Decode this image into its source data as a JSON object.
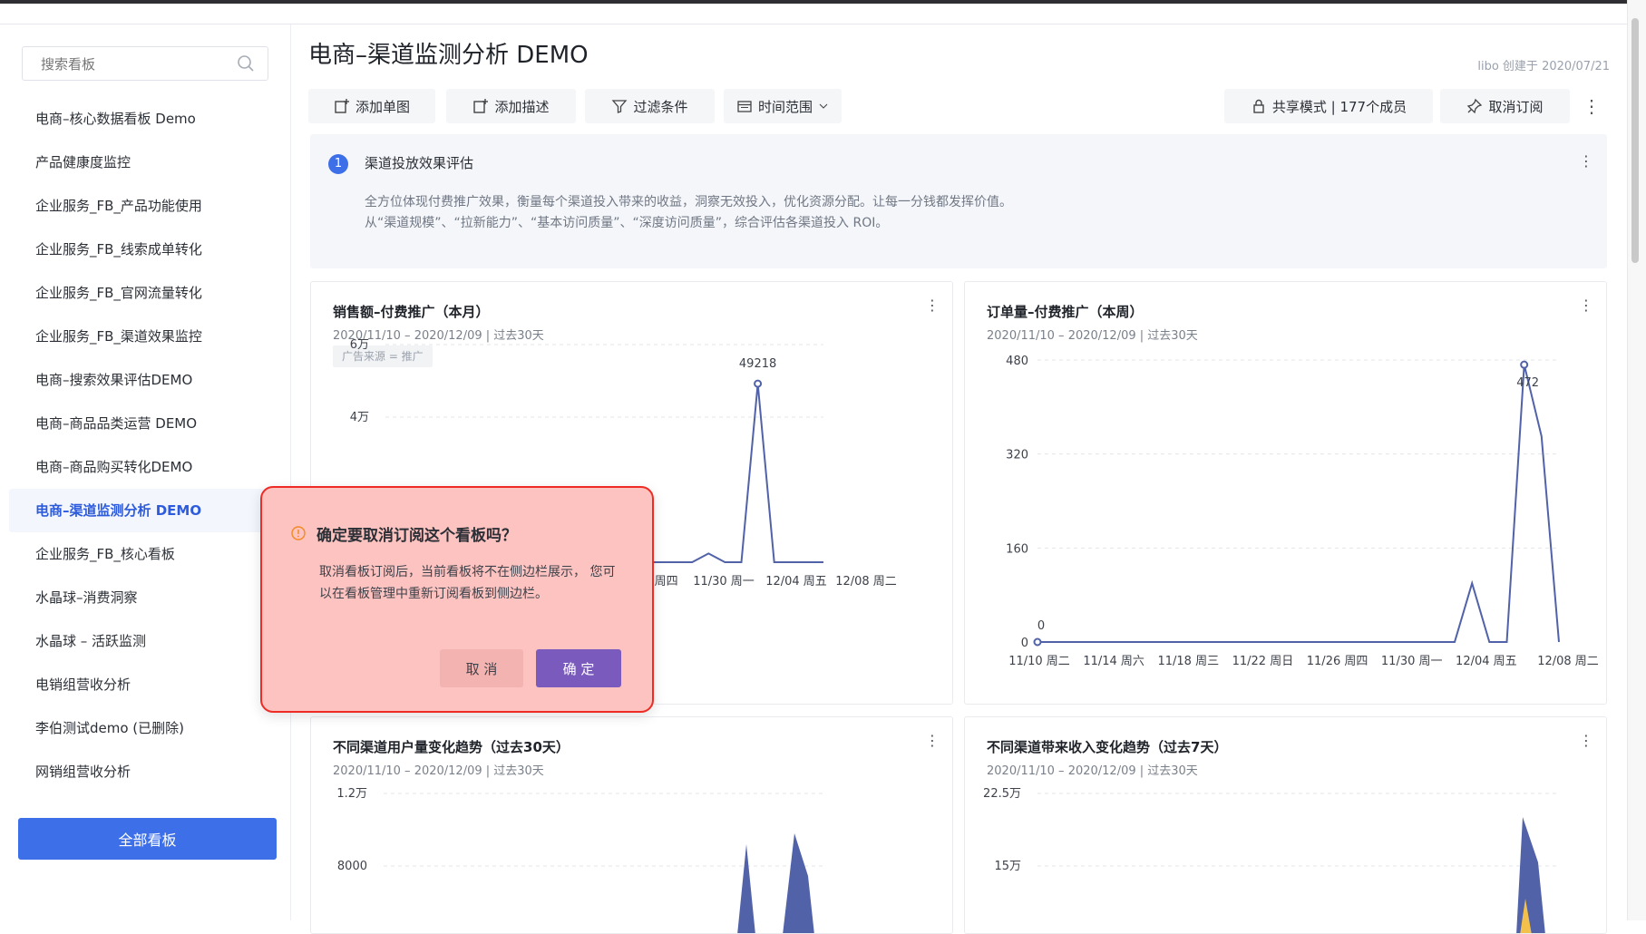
{
  "colors": {
    "accent": "#3d6fe8",
    "line": "#5162a8",
    "dialog_bg": "#fdc3c0",
    "dialog_border": "#ee2b24",
    "confirm": "#7a5bbd",
    "warning": "#f08a24"
  },
  "sidebar": {
    "search_placeholder": "搜索看板",
    "items": [
      {
        "label": "电商–核心数据看板 Demo"
      },
      {
        "label": "产品健康度监控"
      },
      {
        "label": "企业服务_FB_产品功能使用"
      },
      {
        "label": "企业服务_FB_线索成单转化"
      },
      {
        "label": "企业服务_FB_官网流量转化"
      },
      {
        "label": "企业服务_FB_渠道效果监控"
      },
      {
        "label": "电商–搜索效果评估DEMO"
      },
      {
        "label": "电商–商品品类运营 DEMO"
      },
      {
        "label": "电商–商品购买转化DEMO"
      },
      {
        "label": "电商–渠道监测分析 DEMO"
      },
      {
        "label": "企业服务_FB_核心看板"
      },
      {
        "label": "水晶球–消费洞察"
      },
      {
        "label": "水晶球 – 活跃监测"
      },
      {
        "label": "电销组营收分析"
      },
      {
        "label": "李伯测试demo (已删除)"
      },
      {
        "label": "网销组营收分析"
      }
    ],
    "active_index": 9,
    "all_button": "全部看板"
  },
  "header": {
    "title": "电商–渠道监测分析 DEMO",
    "meta": "libo 创建于 2020/07/21"
  },
  "toolbar": {
    "add_chart": "添加单图",
    "add_desc": "添加描述",
    "filter": "过滤条件",
    "time_range": "时间范围",
    "share": "共享模式 | 177个成员",
    "unsubscribe": "取消订阅",
    "more": "⋮"
  },
  "description": {
    "number": "1",
    "title": "渠道投放效果评估",
    "line1": "全方位体现付费推广效果，衡量每个渠道投入带来的收益，洞察无效投入，优化资源分配。让每一分钱都发挥价值。",
    "line2": "从“渠道规模”、“拉新能力”、“基本访问质量”、“深度访问质量”，综合评估各渠道投入 ROI。"
  },
  "charts": {
    "sales": {
      "title": "销售额–付费推广（本月）",
      "subtitle": "2020/11/10 – 2020/12/09 | 过去30天",
      "tag": "广告来源 = 推广"
    },
    "orders": {
      "title": "订单量–付费推广（本周）",
      "subtitle": "2020/11/10 – 2020/12/09 | 过去30天"
    },
    "users": {
      "title": "不同渠道用户量变化趋势（过去30天）",
      "subtitle": "2020/11/10 – 2020/12/09 | 过去30天"
    },
    "revenue": {
      "title": "不同渠道带来收入变化趋势（过去7天）",
      "subtitle": "2020/11/10 – 2020/12/09 | 过去30天"
    }
  },
  "chart_data": [
    {
      "type": "line",
      "title": "销售额–付费推广（本月）",
      "ytick_labels": [
        "6万",
        "4万"
      ],
      "ylim": [
        0,
        60000
      ],
      "xtick_labels": [
        "1/26 周四",
        "11/30 周一",
        "12/04 周五",
        "12/08 周二"
      ],
      "x": [
        0,
        1,
        2,
        3,
        4,
        5,
        6,
        7,
        8,
        9,
        10,
        11,
        12,
        13,
        14,
        15,
        16,
        17,
        18,
        19,
        20,
        21,
        22,
        23,
        24,
        25,
        26,
        27,
        28,
        29
      ],
      "values": [
        0,
        0,
        0,
        0,
        0,
        0,
        0,
        0,
        0,
        0,
        0,
        0,
        0,
        0,
        0,
        0,
        0,
        0,
        0,
        0,
        0,
        0,
        2400,
        0,
        0,
        49218,
        0,
        0,
        0,
        0
      ],
      "annotations": [
        {
          "x": 25,
          "label": "49218"
        }
      ]
    },
    {
      "type": "line",
      "title": "订单量–付费推广（本周）",
      "ytick_labels": [
        "480",
        "320",
        "160",
        "0"
      ],
      "ylim": [
        0,
        480
      ],
      "xtick_labels": [
        "11/10 周二",
        "11/14 周六",
        "11/18 周三",
        "11/22 周日",
        "11/26 周四",
        "11/30 周一",
        "12/04 周五",
        "12/08 周二"
      ],
      "x": [
        0,
        1,
        2,
        3,
        4,
        5,
        6,
        7,
        8,
        9,
        10,
        11,
        12,
        13,
        14,
        15,
        16,
        17,
        18,
        19,
        20,
        21,
        22,
        23,
        24,
        25,
        26,
        27,
        28,
        29
      ],
      "values": [
        0,
        0,
        0,
        0,
        0,
        0,
        0,
        0,
        0,
        0,
        0,
        0,
        0,
        0,
        0,
        0,
        0,
        0,
        0,
        0,
        0,
        0,
        0,
        0,
        0,
        100,
        0,
        0,
        472,
        350,
        0
      ],
      "annotations": [
        {
          "x": 0,
          "label": "0"
        },
        {
          "x": 28,
          "label": "472"
        }
      ]
    },
    {
      "type": "area",
      "title": "不同渠道用户量变化趋势（过去30天）",
      "ytick_labels": [
        "1.2万",
        "8000"
      ],
      "ylim": [
        0,
        12000
      ]
    },
    {
      "type": "area",
      "title": "不同渠道带来收入变化趋势（过去7天）",
      "ytick_labels": [
        "22.5万",
        "15万"
      ],
      "ylim": [
        0,
        225000
      ]
    }
  ],
  "dialog": {
    "title": "确定要取消订阅这个看板吗？",
    "body": "取消看板订阅后，当前看板将不在侧边栏展示，  您可以在看板管理中重新订阅看板到侧边栏。",
    "cancel": "取 消",
    "confirm": "确 定"
  }
}
